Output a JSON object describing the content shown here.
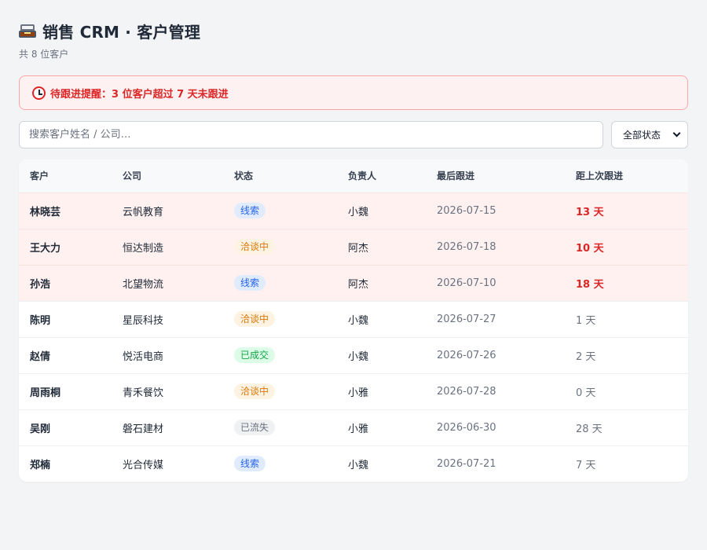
{
  "header": {
    "title": "销售 CRM · 客户管理",
    "subtitle": "共 8 位客户",
    "icon": "inbox-tray-icon"
  },
  "alert": {
    "icon": "alarm-clock-icon",
    "text": "待跟进提醒：3 位客户超过 7 天未跟进"
  },
  "search": {
    "placeholder": "搜索客户姓名 / 公司…",
    "value": ""
  },
  "status_filter": {
    "selected": "全部状态"
  },
  "colors": {
    "alert_red": "#dc2626",
    "overdue_row_bg": "#fef1f0",
    "badge_lead": "#2563eb",
    "badge_negotiating": "#d97706",
    "badge_won": "#16a34a",
    "badge_lost": "#6b7280"
  },
  "table": {
    "columns": [
      "客户",
      "公司",
      "状态",
      "负责人",
      "最后跟进",
      "距上次跟进"
    ],
    "rows": [
      {
        "name": "林晓芸",
        "company": "云帆教育",
        "status": "线索",
        "status_type": "lead",
        "owner": "小魏",
        "last": "2026-07-15",
        "days": "13 天",
        "overdue": true
      },
      {
        "name": "王大力",
        "company": "恒达制造",
        "status": "洽谈中",
        "status_type": "nego",
        "owner": "阿杰",
        "last": "2026-07-18",
        "days": "10 天",
        "overdue": true
      },
      {
        "name": "孙浩",
        "company": "北望物流",
        "status": "线索",
        "status_type": "lead",
        "owner": "阿杰",
        "last": "2026-07-10",
        "days": "18 天",
        "overdue": true
      },
      {
        "name": "陈明",
        "company": "星辰科技",
        "status": "洽谈中",
        "status_type": "nego",
        "owner": "小魏",
        "last": "2026-07-27",
        "days": "1 天",
        "overdue": false
      },
      {
        "name": "赵倩",
        "company": "悦活电商",
        "status": "已成交",
        "status_type": "won",
        "owner": "小魏",
        "last": "2026-07-26",
        "days": "2 天",
        "overdue": false
      },
      {
        "name": "周雨桐",
        "company": "青禾餐饮",
        "status": "洽谈中",
        "status_type": "nego",
        "owner": "小雅",
        "last": "2026-07-28",
        "days": "0 天",
        "overdue": false
      },
      {
        "name": "吴刚",
        "company": "磐石建材",
        "status": "已流失",
        "status_type": "lost",
        "owner": "小雅",
        "last": "2026-06-30",
        "days": "28 天",
        "overdue": false
      },
      {
        "name": "郑楠",
        "company": "光合传媒",
        "status": "线索",
        "status_type": "lead",
        "owner": "小魏",
        "last": "2026-07-21",
        "days": "7 天",
        "overdue": false
      }
    ]
  }
}
